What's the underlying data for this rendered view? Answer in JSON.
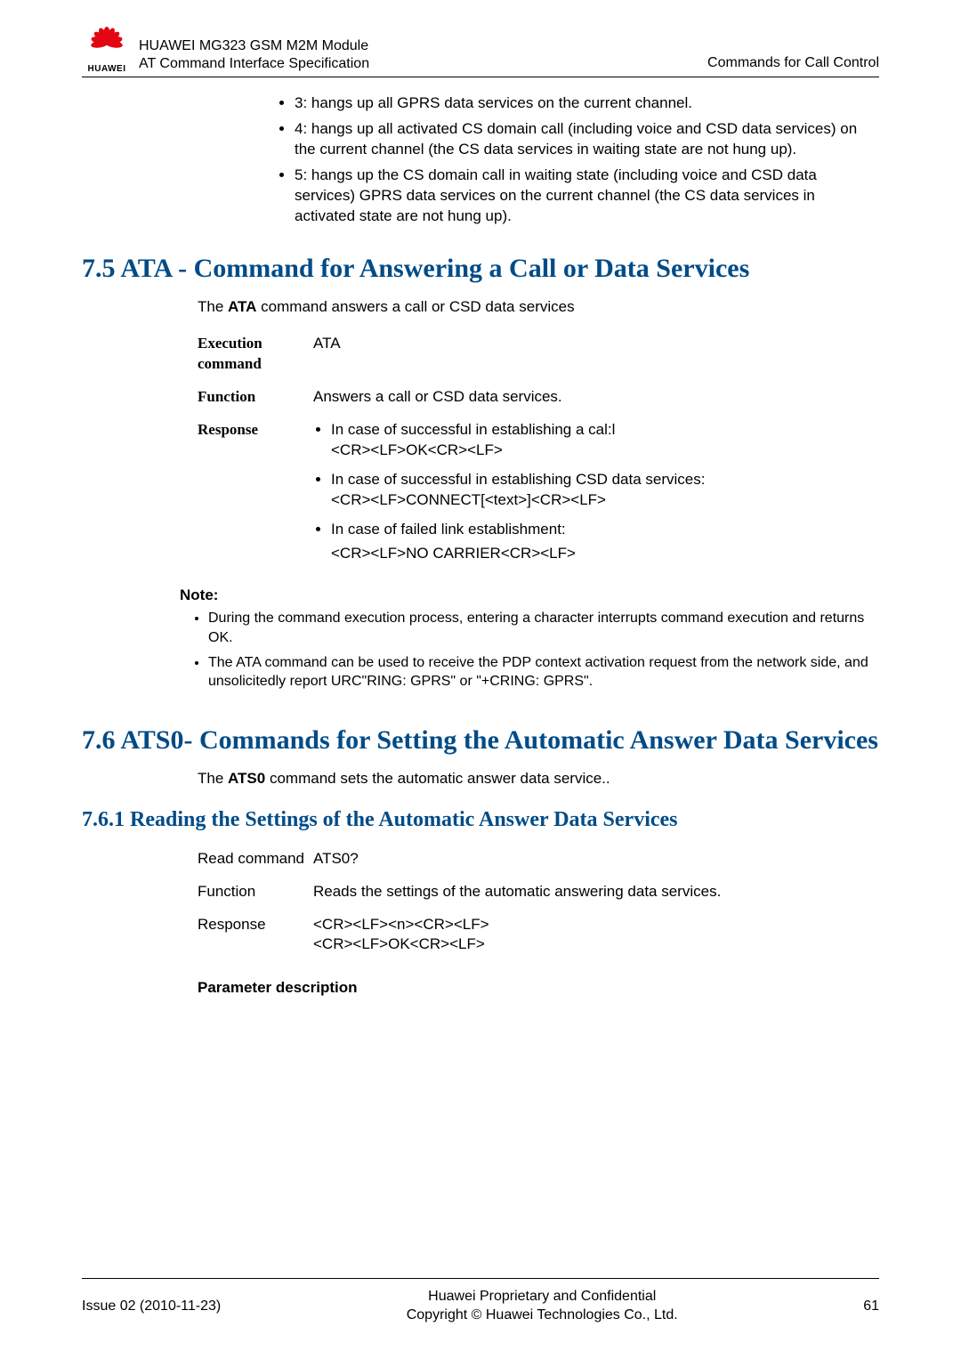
{
  "header": {
    "logo_text": "HUAWEI",
    "title_line1": "HUAWEI MG323 GSM M2M Module",
    "title_line2": "AT Command Interface Specification",
    "right": "Commands for Call Control"
  },
  "top_bullets": [
    "3: hangs up all GPRS data services on the current channel.",
    "4: hangs up all activated CS domain call (including voice and CSD data services) on the current channel (the CS data services in waiting state are not hung up).",
    "5: hangs up the CS domain call in waiting state (including voice and CSD data services) GPRS data services on the current channel (the CS data services in activated state are not hung up)."
  ],
  "sec75": {
    "heading": "7.5 ATA - Command for Answering a Call or Data Services",
    "intro_pre": "The ",
    "intro_cmd": "ATA",
    "intro_post": " command answers a call or CSD data services",
    "rows": {
      "execution_label": "Execution command",
      "execution_value": "ATA",
      "function_label": "Function",
      "function_value": "Answers a call or CSD data services.",
      "response_label": "Response",
      "response_items": [
        {
          "head": "In case of successful in establishing a cal:l",
          "body": "<CR><LF>OK<CR><LF>"
        },
        {
          "head": "In case of successful in establishing CSD data services:",
          "body": "<CR><LF>CONNECT[<text>]<CR><LF>"
        },
        {
          "head": "In case of failed link establishment:",
          "body": "<CR><LF>NO CARRIER<CR><LF>"
        }
      ]
    },
    "note_title": "Note:",
    "notes": [
      "During the command execution process, entering a character interrupts command execution and returns OK.",
      "The ATA command can be used to receive the PDP context activation request from the network side, and unsolicitedly report URC\"RING: GPRS\" or \"+CRING: GPRS\"."
    ]
  },
  "sec76": {
    "heading": "7.6 ATS0- Commands for Setting the Automatic Answer Data Services",
    "intro_pre": "The ",
    "intro_cmd": "ATS0",
    "intro_post": " command sets the automatic answer data service..",
    "sub_heading": "7.6.1 Reading the Settings of the Automatic Answer Data Services",
    "rows": {
      "read_label": "Read command",
      "read_value": "ATS0?",
      "function_label": "Function",
      "function_value": "Reads the settings of the automatic answering data services.",
      "response_label": "Response",
      "response_line1": "<CR><LF><n><CR><LF>",
      "response_line2": "<CR><LF>OK<CR><LF>"
    },
    "param_desc": "Parameter description"
  },
  "footer": {
    "left": "Issue 02 (2010-11-23)",
    "center_line1": "Huawei Proprietary and Confidential",
    "center_line2": "Copyright © Huawei Technologies Co., Ltd.",
    "right": "61"
  }
}
